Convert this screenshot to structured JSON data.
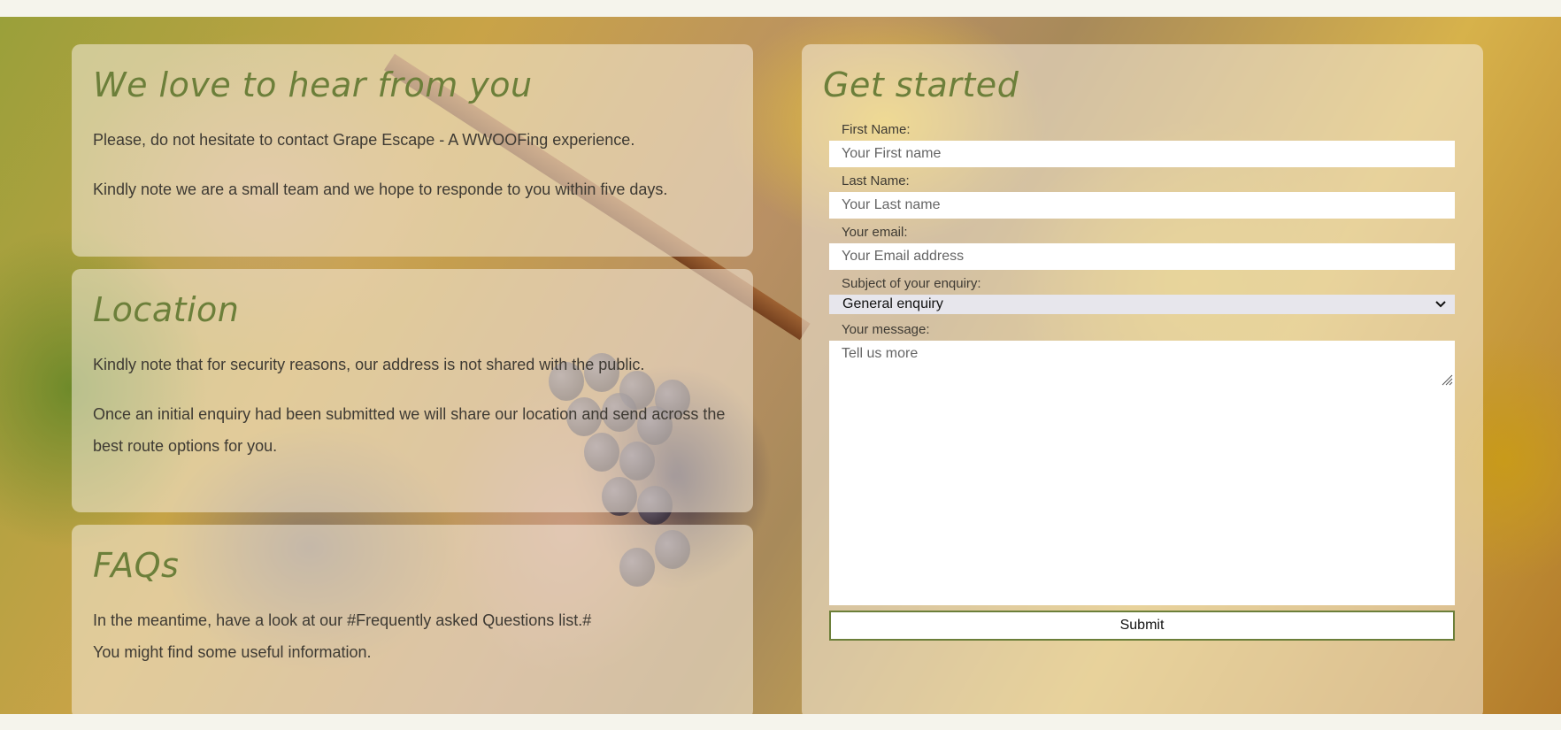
{
  "intro": {
    "title": "We love to hear from you",
    "line1": "Please, do not hesitate to contact Grape Escape - A WWOOFing experience.",
    "line2": "Kindly note we are a small team and we hope to responde to you within five days."
  },
  "location": {
    "title": "Location",
    "line1": "Kindly note that for security reasons, our address is not shared with the public.",
    "line2": "Once an initial enquiry had been submitted we will share our location and send across the best route options for you."
  },
  "faqs": {
    "title": "FAQs",
    "line1": "In the meantime, have a look at our #Frequently asked Questions list.#",
    "line2": "You might find some useful information."
  },
  "form": {
    "title": "Get started",
    "first_name": {
      "label": "First Name:",
      "placeholder": "Your First name"
    },
    "last_name": {
      "label": "Last Name:",
      "placeholder": "Your Last name"
    },
    "email": {
      "label": "Your email:",
      "placeholder": "Your Email address"
    },
    "subject": {
      "label": "Subject of your enquiry:",
      "selected": "General enquiry"
    },
    "message": {
      "label": "Your message:",
      "placeholder": "Tell us more"
    },
    "submit_label": "Submit"
  },
  "colors": {
    "accent": "#6c7f3a",
    "page_bg": "#f5f4ec",
    "text": "#3e3a33"
  },
  "icons": {
    "select_arrow": "chevron-down-icon",
    "resize": "resize-grip-icon"
  }
}
